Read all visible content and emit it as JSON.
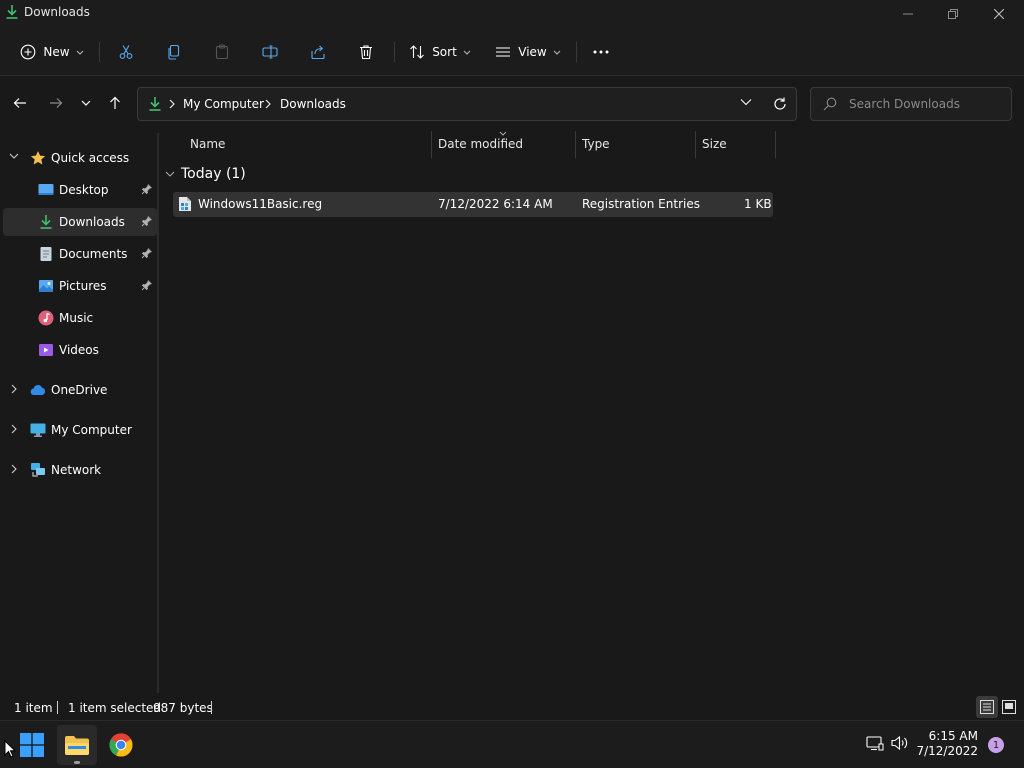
{
  "window": {
    "title": "Downloads",
    "minimize_icon": "minimize-icon",
    "maximize_icon": "restore-icon",
    "close_icon": "close-icon"
  },
  "toolbar": {
    "new_label": "New",
    "sort_label": "Sort",
    "view_label": "View",
    "icons": [
      "plus-circle-icon",
      "cut-icon",
      "copy-icon",
      "paste-icon",
      "rename-icon",
      "share-icon",
      "delete-icon",
      "sort-icon",
      "view-icon",
      "more-icon"
    ]
  },
  "address": {
    "crumbs": [
      "My Computer",
      "Downloads"
    ],
    "folder_icon": "download-arrow-icon"
  },
  "search": {
    "placeholder": "Search Downloads"
  },
  "sidebar": {
    "quick_access": "Quick access",
    "items": [
      {
        "label": "Desktop",
        "icon": "desktop-icon",
        "pinned": true
      },
      {
        "label": "Downloads",
        "icon": "download-arrow-icon",
        "pinned": true,
        "selected": true
      },
      {
        "label": "Documents",
        "icon": "documents-icon",
        "pinned": true
      },
      {
        "label": "Pictures",
        "icon": "pictures-icon",
        "pinned": true
      },
      {
        "label": "Music",
        "icon": "music-icon",
        "pinned": false
      },
      {
        "label": "Videos",
        "icon": "videos-icon",
        "pinned": false
      }
    ],
    "roots": [
      {
        "label": "OneDrive",
        "icon": "cloud-icon"
      },
      {
        "label": "My Computer",
        "icon": "computer-icon"
      },
      {
        "label": "Network",
        "icon": "network-icon"
      }
    ]
  },
  "columns": {
    "name": "Name",
    "date": "Date modified",
    "type": "Type",
    "size": "Size"
  },
  "group": {
    "label": "Today (1)"
  },
  "files": [
    {
      "name": "Windows11Basic.reg",
      "date": "7/12/2022 6:14 AM",
      "type": "Registration Entries",
      "size": "1 KB",
      "icon": "registry-file-icon"
    }
  ],
  "status": {
    "count": "1 item",
    "selected": "1 item selected",
    "bytes": "987 bytes"
  },
  "taskbar": {
    "time": "6:15 AM",
    "date": "7/12/2022",
    "notifications": "1",
    "apps": [
      "windows-start-icon",
      "file-explorer-icon",
      "chrome-icon"
    ]
  },
  "colors": {
    "accent_green": "#3fbf6f",
    "folder_yellow": "#f2c14e",
    "windows_blue": "#3aa0ff"
  }
}
